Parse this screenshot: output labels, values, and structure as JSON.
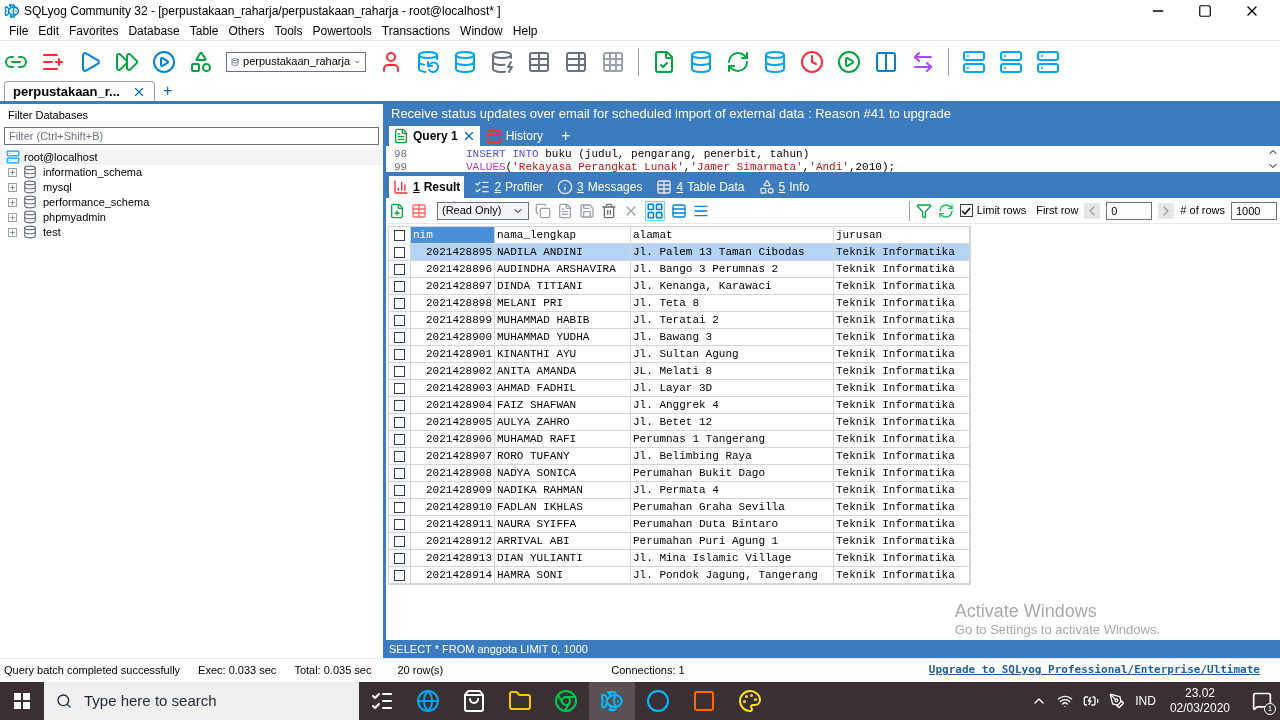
{
  "window": {
    "title": "SQLyog Community 32 - [perpustakaan_raharja/perpustakaan_raharja - root@localhost* ]"
  },
  "menu": [
    "File",
    "Edit",
    "Favorites",
    "Database",
    "Table",
    "Others",
    "Tools",
    "Powertools",
    "Transactions",
    "Window",
    "Help"
  ],
  "toolbar": {
    "database_selector": "perpustakaan_raharja"
  },
  "doc_tabs": [
    {
      "label": "perpustakaan_r...",
      "selected": true
    },
    {
      "label": "+",
      "selected": false
    }
  ],
  "sidebar": {
    "title": "Filter Databases",
    "filter_placeholder": "Filter (Ctrl+Shift+B)",
    "tree": [
      {
        "label": "root@localhost",
        "selected": true,
        "children": [
          {
            "label": "information_schema",
            "expanded": false
          },
          {
            "label": "mysql",
            "expanded": false
          },
          {
            "label": "performance_schema",
            "expanded": false
          },
          {
            "label": "phpmyadmin",
            "expanded": false
          },
          {
            "label": "test",
            "expanded": false
          }
        ]
      }
    ]
  },
  "banner": "Receive status updates over email for scheduled import of external data : Reason #41 to upgrade",
  "query_tabs": [
    {
      "label": "Query 1",
      "selected": true
    },
    {
      "label": "History",
      "selected": false
    },
    {
      "label": "+",
      "selected": false
    }
  ],
  "editor": [
    {
      "number": "98",
      "tokens": [
        {
          "kind": "keyword",
          "text": "INSERT INTO"
        },
        {
          "kind": "plain",
          "text": " buku (judul, pengarang, penerbit, tahun)"
        }
      ]
    },
    {
      "number": "99",
      "tokens": [
        {
          "kind": "function",
          "text": "VALUES"
        },
        {
          "kind": "plain",
          "text": "("
        },
        {
          "kind": "string",
          "text": "'Rekayasa Perangkat Lunak'"
        },
        {
          "kind": "plain",
          "text": ","
        },
        {
          "kind": "string",
          "text": "'Jamer Simarmata'"
        },
        {
          "kind": "plain",
          "text": ","
        },
        {
          "kind": "string",
          "text": "'Andi'"
        },
        {
          "kind": "plain",
          "text": ",2010);"
        }
      ]
    }
  ],
  "result_tabs": [
    {
      "number": "1",
      "label": "Result",
      "selected": true
    },
    {
      "number": "2",
      "label": "Profiler",
      "selected": false
    },
    {
      "number": "3",
      "label": "Messages",
      "selected": false
    },
    {
      "number": "4",
      "label": "Table Data",
      "selected": false
    },
    {
      "number": "5",
      "label": "Info",
      "selected": false
    }
  ],
  "result_toolbar": {
    "mode": "(Read Only)",
    "limit_rows": {
      "label": "Limit rows",
      "checked": true
    },
    "first_row_label": "First row",
    "first_row": "0",
    "rows_label": "# of rows",
    "rows": "1000"
  },
  "table": {
    "select_all": {
      "checked": false
    },
    "columns": [
      "nim",
      "nama_lengkap",
      "alamat",
      "jurusan"
    ],
    "rows": [
      {
        "selected": true,
        "checked": false,
        "cells": [
          "2021428895",
          "NADILA ANDINI",
          "Jl. Palem 13 Taman Cibodas",
          "Teknik Informatika"
        ]
      },
      {
        "selected": false,
        "checked": false,
        "cells": [
          "2021428896",
          "AUDINDHA ARSHAVIRA",
          "Jl. Bango 3 Perumnas 2",
          "Teknik Informatika"
        ]
      },
      {
        "selected": false,
        "checked": false,
        "cells": [
          "2021428897",
          "DINDA TITIANI",
          "Jl. Kenanga, Karawaci",
          "Teknik Informatika"
        ]
      },
      {
        "selected": false,
        "checked": false,
        "cells": [
          "2021428898",
          "MELANI PRI",
          "Jl. Teta 8",
          "Teknik Informatika"
        ]
      },
      {
        "selected": false,
        "checked": false,
        "cells": [
          "2021428899",
          "MUHAMMAD HABIB",
          "Jl. Teratai 2",
          "Teknik Informatika"
        ]
      },
      {
        "selected": false,
        "checked": false,
        "cells": [
          "2021428900",
          "MUHAMMAD YUDHA",
          "Jl. Bawang 3",
          "Teknik Informatika"
        ]
      },
      {
        "selected": false,
        "checked": false,
        "cells": [
          "2021428901",
          "KINANTHI AYU",
          "Jl. Sultan Agung",
          "Teknik Informatika"
        ]
      },
      {
        "selected": false,
        "checked": false,
        "cells": [
          "2021428902",
          "ANITA AMANDA",
          "JL. Melati 8",
          "Teknik Informatika"
        ]
      },
      {
        "selected": false,
        "checked": false,
        "cells": [
          "2021428903",
          "AHMAD FADHIL",
          "Jl. Layar 3D",
          "Teknik Informatika"
        ]
      },
      {
        "selected": false,
        "checked": false,
        "cells": [
          "2021428904",
          "FAIZ SHAFWAN",
          "Jl. Anggrek 4",
          "Teknik Informatika"
        ]
      },
      {
        "selected": false,
        "checked": false,
        "cells": [
          "2021428905",
          "AULYA ZAHRO",
          "Jl. Betet 12",
          "Teknik Informatika"
        ]
      },
      {
        "selected": false,
        "checked": false,
        "cells": [
          "2021428906",
          "MUHAMAD RAFI",
          "Perumnas 1 Tangerang",
          "Teknik Informatika"
        ]
      },
      {
        "selected": false,
        "checked": false,
        "cells": [
          "2021428907",
          "RORO TUFANY",
          "Jl. Belimbing Raya",
          "Teknik Informatika"
        ]
      },
      {
        "selected": false,
        "checked": false,
        "cells": [
          "2021428908",
          "NADYA SONICA",
          "Perumahan Bukit Dago",
          "Teknik Informatika"
        ]
      },
      {
        "selected": false,
        "checked": false,
        "cells": [
          "2021428909",
          "NADIKA RAHMAN",
          "Jl. Permata 4",
          "Teknik Informatika"
        ]
      },
      {
        "selected": false,
        "checked": false,
        "cells": [
          "2021428910",
          "FADLAN IKHLAS",
          "Perumahan Graha Sevilla",
          "Teknik Informatika"
        ]
      },
      {
        "selected": false,
        "checked": false,
        "cells": [
          "2021428911",
          "NAURA SYIFFA",
          "Perumahan Duta Bintaro",
          "Teknik Informatika"
        ]
      },
      {
        "selected": false,
        "checked": false,
        "cells": [
          "2021428912",
          "ARRIVAL ABI",
          "Perumahan Puri Agung 1",
          "Teknik Informatika"
        ]
      },
      {
        "selected": false,
        "checked": false,
        "cells": [
          "2021428913",
          "DIAN YULIANTI",
          "Jl. Mina Islamic Village",
          "Teknik Informatika"
        ]
      },
      {
        "selected": false,
        "checked": false,
        "cells": [
          "2021428914",
          "HAMRA SONI",
          "Jl. Pondok Jagung, Tangerang",
          "Teknik Informatika"
        ]
      }
    ]
  },
  "activation_notice": {
    "title": "Activate Windows",
    "subtitle": "Go to Settings to activate Windows."
  },
  "query_status": "SELECT * FROM anggota LIMIT 0, 1000",
  "status_bar": {
    "items": [
      "Query batch completed successfully",
      "Exec: 0.033 sec",
      "Total: 0.035 sec",
      "20 row(s)",
      "Connections: 1"
    ],
    "link": "Upgrade to SQLyog Professional/Enterprise/Ultimate"
  },
  "taskbar": {
    "search_placeholder": "Type here to search",
    "language": "IND",
    "time": "23.02",
    "date": "02/03/2020",
    "notification_count": "1"
  }
}
